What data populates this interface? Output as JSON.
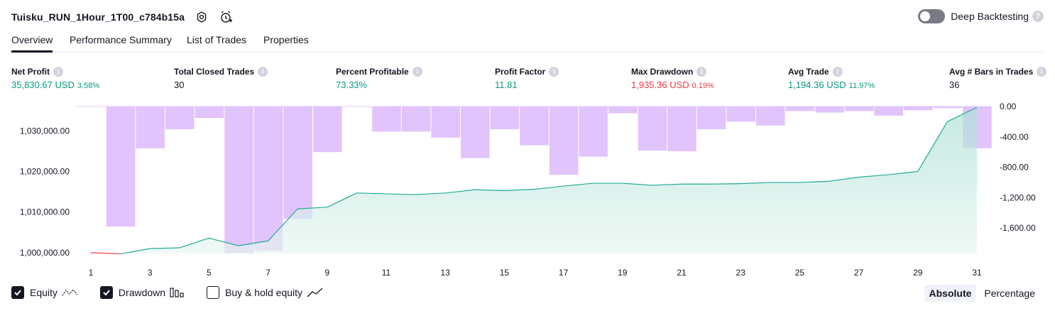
{
  "header": {
    "title": "Tuisku_RUN_1Hour_1T00_c784b15a",
    "deep_backtesting_label": "Deep Backtesting",
    "deep_backtesting_enabled": false
  },
  "tabs": [
    {
      "label": "Overview",
      "active": true
    },
    {
      "label": "Performance Summary",
      "active": false
    },
    {
      "label": "List of Trades",
      "active": false
    },
    {
      "label": "Properties",
      "active": false
    }
  ],
  "metrics": {
    "net_profit": {
      "label": "Net Profit",
      "value": "35,830.67 USD",
      "pct": "3.58%"
    },
    "total_closed_trades": {
      "label": "Total Closed Trades",
      "value": "30"
    },
    "percent_profitable": {
      "label": "Percent Profitable",
      "value": "73.33%"
    },
    "profit_factor": {
      "label": "Profit Factor",
      "value": "11.81"
    },
    "max_drawdown": {
      "label": "Max Drawdown",
      "value": "1,935.36 USD",
      "pct": "0.19%"
    },
    "avg_trade": {
      "label": "Avg Trade",
      "value": "1,194.36 USD",
      "pct": "11.97%"
    },
    "avg_bars": {
      "label": "Avg # Bars in Trades",
      "value": "36"
    }
  },
  "legend": {
    "equity": {
      "label": "Equity",
      "checked": true
    },
    "drawdown": {
      "label": "Drawdown",
      "checked": true
    },
    "buy_hold": {
      "label": "Buy & hold equity",
      "checked": false
    }
  },
  "modes": {
    "absolute": "Absolute",
    "percentage": "Percentage",
    "active": "absolute"
  },
  "colors": {
    "equity_line": "#22ab94",
    "equity_negative": "#f23645",
    "equity_fill": "#d4efe8",
    "drawdown_bar": "#e1c4fc",
    "positive": "#089981",
    "negative": "#f23645"
  },
  "chart_data": {
    "type": "bar",
    "x": [
      1,
      2,
      3,
      4,
      5,
      6,
      7,
      8,
      9,
      10,
      11,
      12,
      13,
      14,
      15,
      16,
      17,
      18,
      19,
      20,
      21,
      22,
      23,
      24,
      25,
      26,
      27,
      28,
      29,
      30,
      31
    ],
    "x_ticks": [
      "1",
      "3",
      "5",
      "7",
      "9",
      "11",
      "13",
      "15",
      "17",
      "19",
      "21",
      "23",
      "25",
      "27",
      "29",
      "31"
    ],
    "left_axis": {
      "ticks": [
        "1,030,000.00",
        "1,020,000.00",
        "1,010,000.00",
        "1,000,000.00"
      ],
      "tick_values": [
        1030000,
        1020000,
        1010000,
        1000000
      ],
      "range": [
        999800,
        1036000
      ]
    },
    "right_axis": {
      "ticks": [
        "0.00",
        "-400.00",
        "-800.00",
        "-1,200.00",
        "-1,600.00"
      ],
      "tick_values": [
        0,
        -400,
        -800,
        -1200,
        -1600
      ],
      "range": [
        -1935,
        0
      ]
    },
    "series": [
      {
        "name": "Equity",
        "type": "area",
        "values": [
          1000000,
          999700,
          1001000,
          1001200,
          1003600,
          1001700,
          1002900,
          1010800,
          1011200,
          1014700,
          1014500,
          1014300,
          1014700,
          1015500,
          1015300,
          1015600,
          1016400,
          1017100,
          1017100,
          1016600,
          1016900,
          1016900,
          1017000,
          1017300,
          1017300,
          1017600,
          1018600,
          1019200,
          1020000,
          1032300,
          1035800
        ]
      },
      {
        "name": "Drawdown",
        "type": "bar",
        "values": [
          0,
          -1580,
          -550,
          -300,
          -150,
          -1935,
          -1900,
          -1480,
          -600,
          0,
          -330,
          -330,
          -410,
          -680,
          -300,
          -510,
          -900,
          -660,
          -90,
          -580,
          -590,
          -300,
          -200,
          -250,
          -60,
          -80,
          -60,
          -120,
          -50,
          -20,
          -550
        ]
      }
    ]
  }
}
